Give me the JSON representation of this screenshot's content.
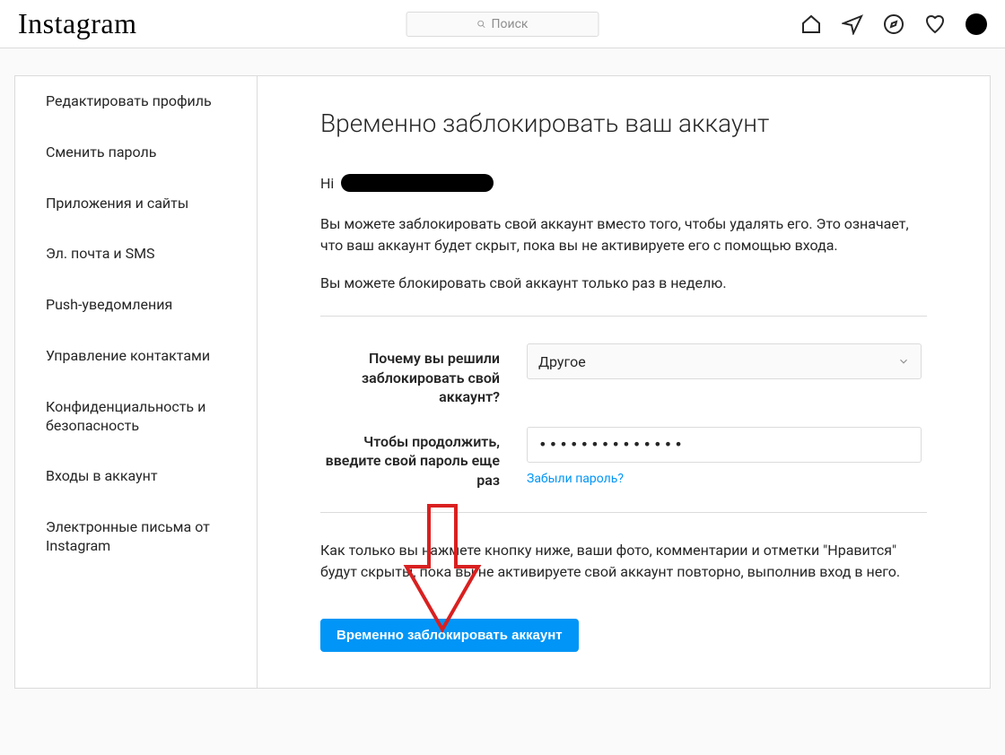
{
  "nav": {
    "logo": "Instagram",
    "search_placeholder": "Поиск"
  },
  "sidebar": {
    "items": [
      "Редактировать профиль",
      "Сменить пароль",
      "Приложения и сайты",
      "Эл. почта и SMS",
      "Push-уведомления",
      "Управление контактами",
      "Конфиденциальность и безопасность",
      "Входы в аккаунт",
      "Электронные письма от Instagram"
    ]
  },
  "main": {
    "title": "Временно заблокировать ваш аккаунт",
    "greeting_prefix": "Hi",
    "para1": "Вы можете заблокировать свой аккаунт вместо того, чтобы удалять его. Это означает, что ваш аккаунт будет скрыт, пока вы не активируете его с помощью входа.",
    "para2": "Вы можете блокировать свой аккаунт только раз в неделю.",
    "reason_label": "Почему вы решили заблокировать свой аккаунт?",
    "reason_value": "Другое",
    "password_label": "Чтобы продолжить, введите свой пароль еще раз",
    "password_masked": "••••••••••••••",
    "forgot_password": "Забыли пароль?",
    "final_para": "Как только вы нажмете кнопку ниже, ваши фото, комментарии и отметки \"Нравится\" будут скрыты, пока вы не активируете свой аккаунт повторно, выполнив вход в него.",
    "submit_label": "Временно заблокировать аккаунт"
  }
}
